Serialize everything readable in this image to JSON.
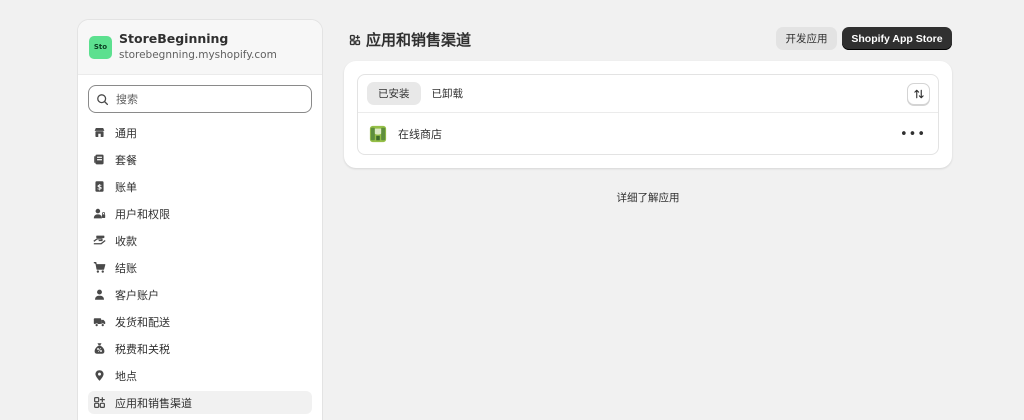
{
  "store": {
    "avatar_text": "Sto",
    "name": "StoreBeginning",
    "domain": "storebegnning.myshopify.com"
  },
  "search": {
    "placeholder": "搜索"
  },
  "nav": {
    "items": [
      {
        "label": "通用",
        "icon": "store-icon"
      },
      {
        "label": "套餐",
        "icon": "plan-icon"
      },
      {
        "label": "账单",
        "icon": "billing-icon"
      },
      {
        "label": "用户和权限",
        "icon": "users-icon"
      },
      {
        "label": "收款",
        "icon": "payments-icon"
      },
      {
        "label": "结账",
        "icon": "cart-icon"
      },
      {
        "label": "客户账户",
        "icon": "person-icon"
      },
      {
        "label": "发货和配送",
        "icon": "truck-icon"
      },
      {
        "label": "税费和关税",
        "icon": "tax-icon"
      },
      {
        "label": "地点",
        "icon": "location-icon"
      },
      {
        "label": "应用和销售渠道",
        "icon": "apps-icon",
        "active": true
      }
    ]
  },
  "header": {
    "title": "应用和销售渠道",
    "dev_button": "开发应用",
    "store_button": "Shopify App Store"
  },
  "tabs": [
    {
      "label": "已安装",
      "active": true
    },
    {
      "label": "已卸载",
      "active": false
    }
  ],
  "apps": [
    {
      "name": "在线商店",
      "icon": "online-store-icon"
    }
  ],
  "footer": {
    "learn_more": "详细了解应用"
  },
  "colors": {
    "avatar_bg": "#5ce08f",
    "primary_button": "#303030",
    "background": "#f1f1f1"
  }
}
